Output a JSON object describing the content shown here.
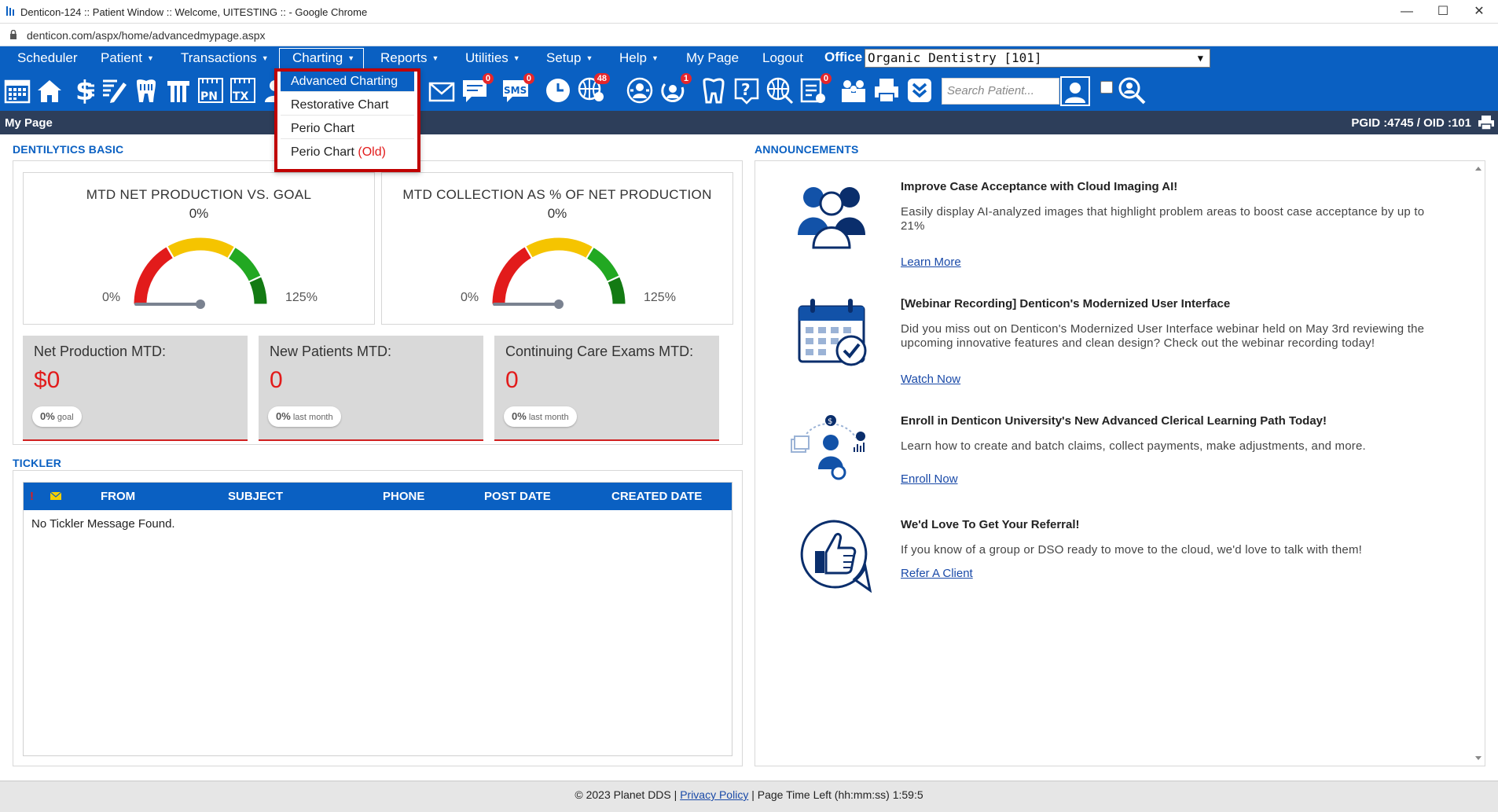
{
  "window": {
    "title": "Denticon-124 :: Patient Window :: Welcome, UITESTING :: - Google Chrome",
    "url": "denticon.com/aspx/home/advancedmypage.aspx",
    "minimize": "—",
    "maximize": "☐",
    "close": "✕"
  },
  "nav": {
    "items": [
      {
        "label": "Scheduler",
        "caret": false
      },
      {
        "label": "Patient",
        "caret": true
      },
      {
        "label": "Transactions",
        "caret": true
      },
      {
        "label": "Charting",
        "caret": true
      },
      {
        "label": "Reports",
        "caret": true
      },
      {
        "label": "Utilities",
        "caret": true
      },
      {
        "label": "Setup",
        "caret": true
      },
      {
        "label": "Help",
        "caret": true
      },
      {
        "label": "My Page",
        "caret": false
      },
      {
        "label": "Logout",
        "caret": false
      }
    ],
    "caret_glyph": "▼",
    "office_label": "Office",
    "office_value": "Organic Dentistry [101]"
  },
  "charting_menu": {
    "items": [
      "Advanced Charting",
      "Restorative Chart",
      "Perio Chart",
      "Perio Chart"
    ],
    "old_suffix": "(Old)"
  },
  "toolbar": {
    "icons": [
      "calendar-icon",
      "home-icon",
      "dollar-icon",
      "notes-edit-icon",
      "tooth-icon",
      "dentures-icon",
      "pn-icon",
      "tx-icon",
      "user-icon",
      "mail-icon",
      "chat-icon",
      "sms-icon",
      "clock-icon",
      "globe-users-icon",
      "support-icon",
      "referral-icon",
      "tooth-outline-icon",
      "help-icon",
      "web-icon",
      "checklist-icon",
      "family-icon",
      "print-icon",
      "chevron-down-icon"
    ],
    "badges": {
      "chat": "0",
      "sms": "0",
      "globe": "48",
      "referral": "1",
      "checklist": "0"
    },
    "pn_text": "PN",
    "tx_text": "TX",
    "sms_text": "SMS",
    "search_placeholder": "Search Patient..."
  },
  "mypage_bar": {
    "title": "My Page",
    "ids": "PGID :4745  /  OID :101"
  },
  "dentilytics": {
    "title": "DENTILYTICS BASIC",
    "gauges": [
      {
        "title": "MTD NET PRODUCTION VS. GOAL",
        "value": "0%",
        "min_label": "0%",
        "max_label": "125%",
        "level_percent": 0
      },
      {
        "title": "MTD COLLECTION AS % OF NET PRODUCTION",
        "value": "0%",
        "min_label": "0%",
        "max_label": "125%",
        "level_percent": 0
      }
    ],
    "kpis": [
      {
        "title": "Net Production MTD:",
        "value": "$0",
        "badge_pct": "0%",
        "badge_text": "goal"
      },
      {
        "title": "New Patients MTD:",
        "value": "0",
        "badge_pct": "0%",
        "badge_text": "last month"
      },
      {
        "title": "Continuing Care Exams MTD:",
        "value": "0",
        "badge_pct": "0%",
        "badge_text": "last month"
      }
    ],
    "colors": {
      "red": "#e21b1b",
      "yellow": "#f5c400",
      "green": "#22a822",
      "dark_green": "#137a13"
    }
  },
  "tickler": {
    "title": "TICKLER",
    "columns": [
      "!",
      "FROM",
      "SUBJECT",
      "PHONE",
      "POST DATE",
      "CREATED DATE"
    ],
    "empty_message": "No Tickler Message Found."
  },
  "announcements": {
    "title": "ANNOUNCEMENTS",
    "items": [
      {
        "title": "Improve Case Acceptance with Cloud Imaging AI!",
        "body": "Easily display AI-analyzed images that highlight problem areas to boost case acceptance by up to 21%",
        "link": "Learn More",
        "icon": "people-group-icon"
      },
      {
        "title": "[Webinar Recording] Denticon's Modernized User Interface",
        "body": "Did you miss out on Denticon's Modernized User Interface webinar held on May 3rd reviewing the upcoming innovative features and clean design? Check out the webinar recording today!",
        "link": "Watch Now",
        "icon": "calendar-check-icon"
      },
      {
        "title": "Enroll in Denticon University's New Advanced Clerical Learning Path Today!",
        "body": "Learn how to create and batch claims, collect payments, make adjustments, and more.",
        "link": "Enroll Now",
        "icon": "learning-path-icon"
      },
      {
        "title": "We'd Love To Get Your Referral!",
        "body": "If you know of a group or DSO ready to move to the cloud, we'd love to talk with them!",
        "link": "Refer A Client",
        "icon": "thumbs-up-icon"
      }
    ]
  },
  "footer": {
    "copyright": "© 2023 Planet DDS |",
    "privacy": "Privacy Policy",
    "sep": "|",
    "time_left": "Page Time Left (hh:mm:ss) 1:59:5"
  }
}
